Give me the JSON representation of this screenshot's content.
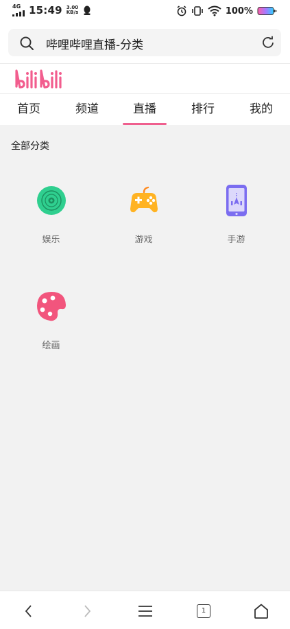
{
  "status_bar": {
    "network": "4G",
    "time": "15:49",
    "speed_value": "3.00",
    "speed_unit": "KB/s",
    "battery": "100%"
  },
  "address_bar": {
    "text": "哔哩哔哩直播-分类"
  },
  "logo": {
    "text": "bilibili",
    "color": "#f25d8e"
  },
  "nav": {
    "tabs": [
      {
        "label": "首页",
        "active": false
      },
      {
        "label": "频道",
        "active": false
      },
      {
        "label": "直播",
        "active": true
      },
      {
        "label": "排行",
        "active": false
      },
      {
        "label": "我的",
        "active": false
      }
    ],
    "accent_color": "#ef5f8e"
  },
  "main": {
    "section_title": "全部分类",
    "categories": [
      {
        "label": "娱乐",
        "icon": "music-disc-icon",
        "color": "#2fcf8f"
      },
      {
        "label": "游戏",
        "icon": "gamepad-icon",
        "color": "#ffb323"
      },
      {
        "label": "手游",
        "icon": "mobile-game-icon",
        "color": "#7b6df0"
      },
      {
        "label": "绘画",
        "icon": "palette-icon",
        "color": "#f2557d"
      }
    ]
  },
  "bottom_bar": {
    "tab_count": "1"
  }
}
